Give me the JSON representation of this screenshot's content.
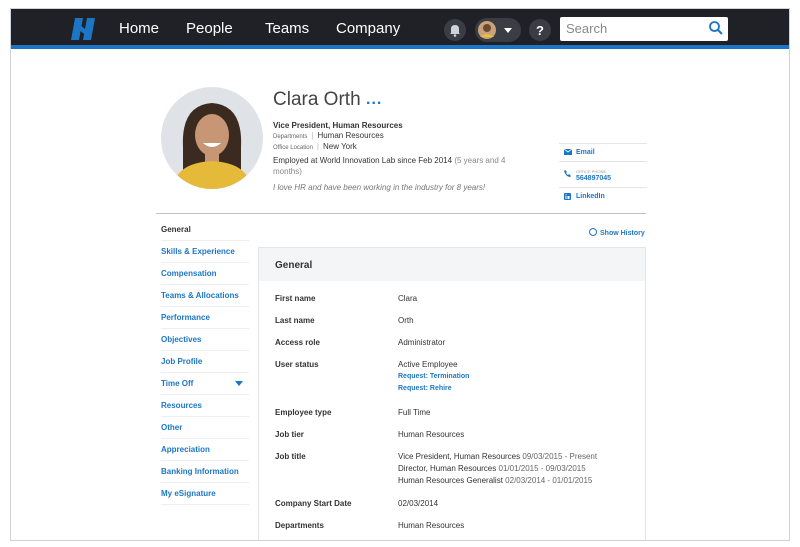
{
  "nav": {
    "items": [
      "Home",
      "People",
      "Teams",
      "Company"
    ],
    "search_placeholder": "Search"
  },
  "profile": {
    "name": "Clara Orth",
    "more": "...",
    "job_title": "Vice President, Human Resources",
    "departments_label": "Departments",
    "departments_value": "Human Resources",
    "office_label": "Office Location",
    "office_value": "New York",
    "employed": "Employed at World Innovation Lab since Feb 2014",
    "tenure": "(5 years and 4 months)",
    "quote": "I love HR and have been working in the industry for 8 years!"
  },
  "contact": {
    "email": "Email",
    "phone_label": "OFFICE PHONE:",
    "phone_value": "564897045",
    "linkedin": "LinkedIn"
  },
  "sidebar": {
    "items": [
      "General",
      "Skills & Experience",
      "Compensation",
      "Teams & Allocations",
      "Performance",
      "Objectives",
      "Job Profile",
      "Time Off",
      "Resources",
      "Other",
      "Appreciation",
      "Banking Information",
      "My eSignature"
    ]
  },
  "show_history": "Show History",
  "panel": {
    "title": "General",
    "fields": {
      "first_name": {
        "label": "First name",
        "value": "Clara"
      },
      "last_name": {
        "label": "Last name",
        "value": "Orth"
      },
      "access_role": {
        "label": "Access role",
        "value": "Administrator"
      },
      "user_status": {
        "label": "User status",
        "value": "Active Employee",
        "link1": "Request: Termination",
        "link2": "Request: Rehire"
      },
      "employee_type": {
        "label": "Employee type",
        "value": "Full Time"
      },
      "job_tier": {
        "label": "Job tier",
        "value": "Human Resources"
      },
      "job_title": {
        "label": "Job title",
        "lines": [
          {
            "title": "Vice President, Human Resources",
            "dates": "09/03/2015 - Present"
          },
          {
            "title": "Director, Human Resources",
            "dates": "01/01/2015 - 09/03/2015"
          },
          {
            "title": "Human Resources Generalist",
            "dates": "02/03/2014 - 01/01/2015"
          }
        ]
      },
      "start_date": {
        "label": "Company Start Date",
        "value": "02/03/2014"
      },
      "departments": {
        "label": "Departments",
        "value": "Human Resources"
      }
    }
  },
  "colors": {
    "accent": "#1d76c5",
    "topbar": "#1f2126"
  }
}
